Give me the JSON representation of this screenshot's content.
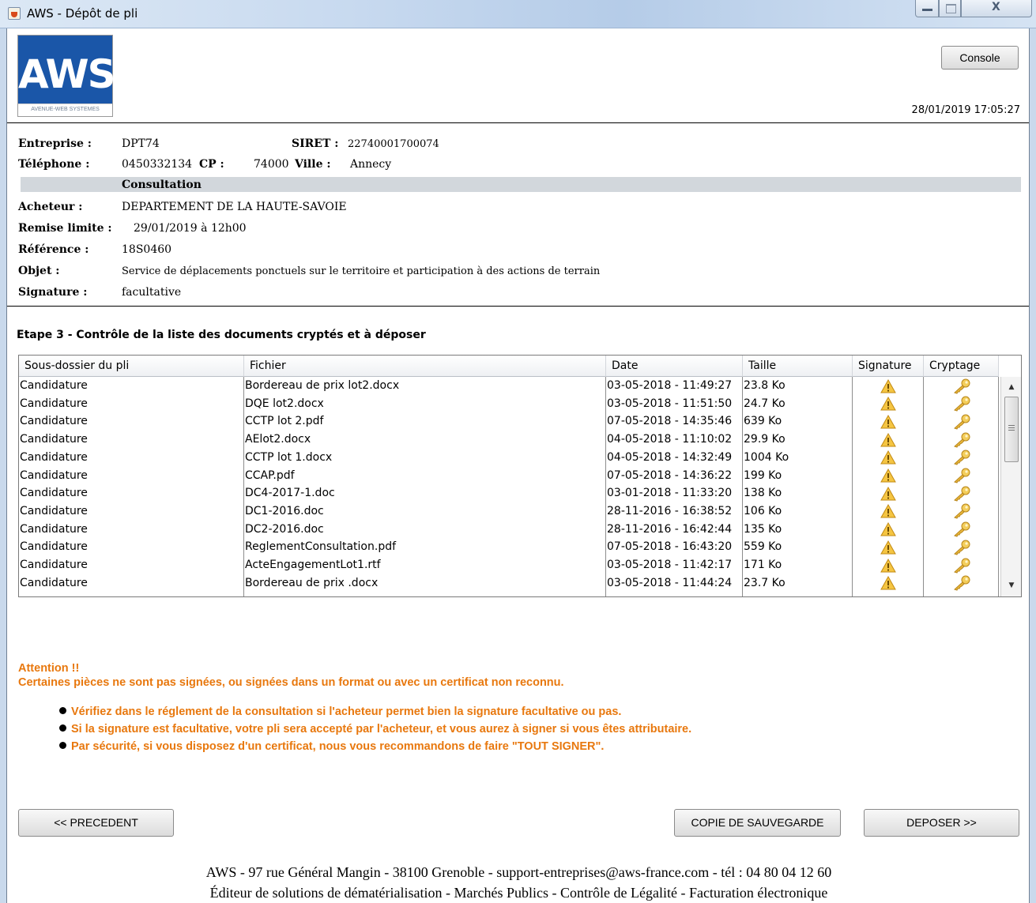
{
  "window": {
    "title": "AWS - Dépôt de pli"
  },
  "header": {
    "logo_text": "AWS",
    "logo_sub": "AVENUE-WEB SYSTEMES",
    "console_label": "Console",
    "datetime": "28/01/2019 17:05:27"
  },
  "info": {
    "entreprise_label": "Entreprise :",
    "entreprise": "DPT74",
    "siret_label": "SIRET :",
    "siret": "22740001700074",
    "telephone_label": "Téléphone :",
    "telephone": "0450332134",
    "cp_label": "CP :",
    "cp": "74000",
    "ville_label": "Ville :",
    "ville": "Annecy",
    "consultation_label": "Consultation",
    "acheteur_label": "Acheteur :",
    "acheteur": "DEPARTEMENT DE LA HAUTE-SAVOIE",
    "remise_label": "Remise limite :",
    "remise": "29/01/2019 à 12h00",
    "reference_label": "Référence :",
    "reference": "18S0460",
    "objet_label": "Objet :",
    "objet": "Service de déplacements ponctuels sur le territoire et participation à des actions de terrain",
    "signature_label": "Signature :",
    "signature": "facultative"
  },
  "step": {
    "title": "Etape 3 - Contrôle de la liste des documents cryptés et à déposer"
  },
  "table": {
    "columns": [
      "Sous-dossier du pli",
      "Fichier",
      "Date",
      "Taille",
      "Signature",
      "Cryptage"
    ],
    "rows": [
      {
        "sous_dossier": "Candidature",
        "fichier": "Bordereau de prix lot2.docx",
        "date": "03-05-2018 - 11:49:27",
        "taille": "23.8 Ko",
        "signature_icon": "warning-icon",
        "cryptage_icon": "key-icon"
      },
      {
        "sous_dossier": "Candidature",
        "fichier": "DQE lot2.docx",
        "date": "03-05-2018 - 11:51:50",
        "taille": "24.7 Ko",
        "signature_icon": "warning-icon",
        "cryptage_icon": "key-icon"
      },
      {
        "sous_dossier": "Candidature",
        "fichier": "CCTP lot 2.pdf",
        "date": "07-05-2018 - 14:35:46",
        "taille": "639 Ko",
        "signature_icon": "warning-icon",
        "cryptage_icon": "key-icon"
      },
      {
        "sous_dossier": "Candidature",
        "fichier": "AElot2.docx",
        "date": "04-05-2018 - 11:10:02",
        "taille": "29.9 Ko",
        "signature_icon": "warning-icon",
        "cryptage_icon": "key-icon"
      },
      {
        "sous_dossier": "Candidature",
        "fichier": "CCTP lot 1.docx",
        "date": "04-05-2018 - 14:32:49",
        "taille": "1004 Ko",
        "signature_icon": "warning-icon",
        "cryptage_icon": "key-icon"
      },
      {
        "sous_dossier": "Candidature",
        "fichier": "CCAP.pdf",
        "date": "07-05-2018 - 14:36:22",
        "taille": "199 Ko",
        "signature_icon": "warning-icon",
        "cryptage_icon": "key-icon"
      },
      {
        "sous_dossier": "Candidature",
        "fichier": "DC4-2017-1.doc",
        "date": "03-01-2018 - 11:33:20",
        "taille": "138 Ko",
        "signature_icon": "warning-icon",
        "cryptage_icon": "key-icon"
      },
      {
        "sous_dossier": "Candidature",
        "fichier": "DC1-2016.doc",
        "date": "28-11-2016 - 16:38:52",
        "taille": "106 Ko",
        "signature_icon": "warning-icon",
        "cryptage_icon": "key-icon"
      },
      {
        "sous_dossier": "Candidature",
        "fichier": "DC2-2016.doc",
        "date": "28-11-2016 - 16:42:44",
        "taille": "135 Ko",
        "signature_icon": "warning-icon",
        "cryptage_icon": "key-icon"
      },
      {
        "sous_dossier": "Candidature",
        "fichier": "ReglementConsultation.pdf",
        "date": "07-05-2018 - 16:43:20",
        "taille": "559 Ko",
        "signature_icon": "warning-icon",
        "cryptage_icon": "key-icon"
      },
      {
        "sous_dossier": "Candidature",
        "fichier": "ActeEngagementLot1.rtf",
        "date": "03-05-2018 - 11:42:17",
        "taille": "171 Ko",
        "signature_icon": "warning-icon",
        "cryptage_icon": "key-icon"
      },
      {
        "sous_dossier": "Candidature",
        "fichier": "Bordereau de prix .docx",
        "date": "03-05-2018 - 11:44:24",
        "taille": "23.7 Ko",
        "signature_icon": "warning-icon",
        "cryptage_icon": "key-icon"
      }
    ]
  },
  "attention": {
    "title": "Attention !!",
    "message": "Certaines pièces ne sont pas signées, ou signées dans un format ou avec un certificat non reconnu.",
    "bullets": [
      "Vérifiez dans le réglement de la consultation si l'acheteur permet bien la signature facultative ou pas.",
      "Si la signature est facultative, votre pli sera accepté par l'acheteur, et vous aurez à signer si vous êtes attributaire.",
      "Par sécurité, si vous disposez d'un certificat, nous vous recommandons de faire \"TOUT SIGNER\"."
    ],
    "color": "#e8780e"
  },
  "buttons": {
    "prev": "<< PRECEDENT",
    "backup": "COPIE DE SAUVEGARDE",
    "deposit": "DEPOSER >>"
  },
  "footer": {
    "line1": "AWS - 97 rue Général Mangin - 38100 Grenoble - support-entreprises@aws-france.com - tél : 04 80 04 12 60",
    "line2": "Éditeur de solutions de dématérialisation - Marchés Publics - Contrôle de Légalité - Facturation électronique"
  }
}
